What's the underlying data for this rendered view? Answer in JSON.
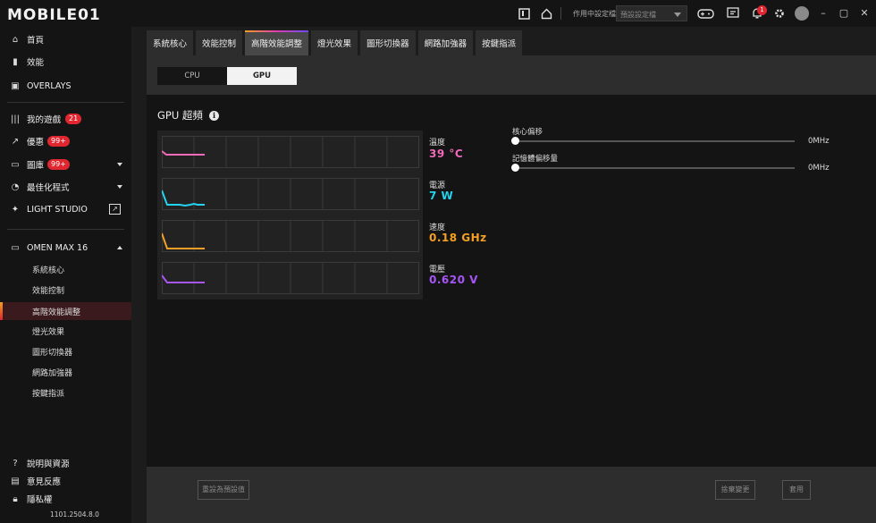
{
  "titlebar": {
    "logo_text": "MOBILE01",
    "profile_label": "作用中設定檔",
    "profile_select": "預設設定檔",
    "notification_count": "1"
  },
  "sidebar": {
    "items": [
      {
        "label": "首頁",
        "icon": "home-icon"
      },
      {
        "label": "效能",
        "icon": "performance-icon"
      },
      {
        "label": "OVERLAYS",
        "icon": "overlay-icon"
      },
      {
        "label": "我的遊戲",
        "icon": "library-icon",
        "badge": "21"
      },
      {
        "label": "優惠",
        "icon": "trend-icon",
        "badge": "99+"
      },
      {
        "label": "圖庫",
        "icon": "gallery-icon",
        "badge": "99+"
      },
      {
        "label": "最佳化程式",
        "icon": "optimizer-icon"
      },
      {
        "label": "LIGHT STUDIO",
        "icon": "sparkle-icon"
      }
    ],
    "device": {
      "label": "OMEN MAX 16",
      "icon": "laptop-icon"
    },
    "sub_items": [
      "系統核心",
      "效能控制",
      "高階效能調整",
      "燈光效果",
      "圖形切換器",
      "網路加強器",
      "按鍵指派"
    ],
    "bottom_items": [
      {
        "label": "說明與資源",
        "icon": "help-icon"
      },
      {
        "label": "意見反應",
        "icon": "feedback-icon"
      },
      {
        "label": "隱私權",
        "icon": "lock-icon"
      }
    ],
    "version": "1101.2504.8.0"
  },
  "tabs": [
    "系統核心",
    "效能控制",
    "高階效能調整",
    "燈光效果",
    "圖形切換器",
    "網路加強器",
    "按鍵指派"
  ],
  "active_tab": 2,
  "segments": {
    "cpu": "CPU",
    "gpu": "GPU"
  },
  "section": {
    "title": "GPU 超頻"
  },
  "metrics": [
    {
      "label": "溫度",
      "value": "39 °C",
      "color": "#f06ab8"
    },
    {
      "label": "電源",
      "value": "7 W",
      "color": "#22d4ee"
    },
    {
      "label": "速度",
      "value": "0.18 GHz",
      "color": "#f5a024"
    },
    {
      "label": "電壓",
      "value": "0.620 V",
      "color": "#a855f7"
    }
  ],
  "sliders": [
    {
      "label": "核心偏移",
      "value": "0MHz"
    },
    {
      "label": "記憶體偏移量",
      "value": "0MHz"
    }
  ],
  "footer": {
    "reset": "重設為預設值",
    "discard": "捨棄變更",
    "apply": "套用"
  }
}
